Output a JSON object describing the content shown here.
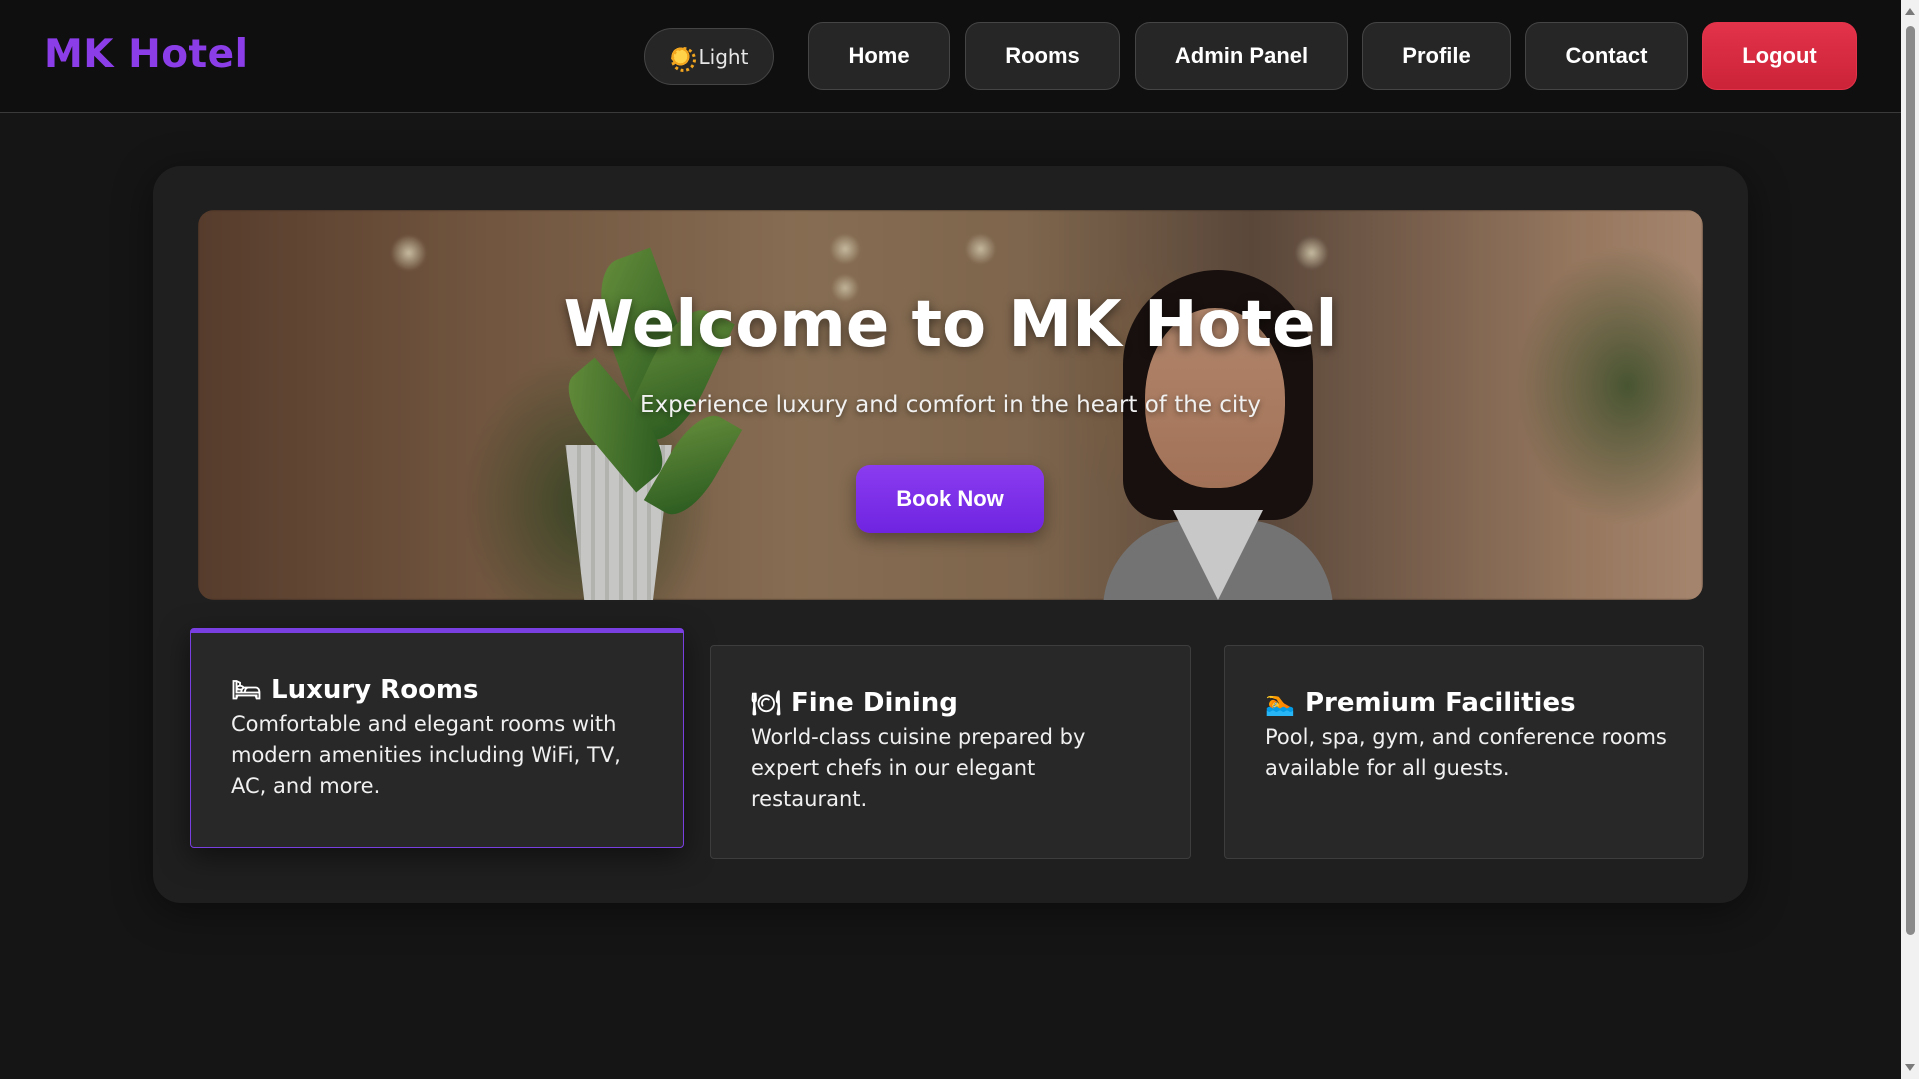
{
  "header": {
    "brand": "MK Hotel",
    "theme_toggle": {
      "icon": "sun-icon",
      "label": "Light"
    },
    "nav": [
      {
        "label": "Home"
      },
      {
        "label": "Rooms"
      },
      {
        "label": "Admin Panel"
      },
      {
        "label": "Profile"
      },
      {
        "label": "Contact"
      },
      {
        "label": "Logout"
      }
    ]
  },
  "hero": {
    "title": "Welcome to MK Hotel",
    "subtitle": "Experience luxury and comfort in the heart of the city",
    "button_label": "Book Now"
  },
  "features": [
    {
      "icon": "bed-icon",
      "glyph": "🛏",
      "title": "Luxury Rooms",
      "description": "Comfortable and elegant rooms with modern amenities including WiFi, TV, AC, and more."
    },
    {
      "icon": "plate-icon",
      "glyph": "🍽",
      "title": "Fine Dining",
      "description": "World-class cuisine prepared by expert chefs in our elegant restaurant."
    },
    {
      "icon": "swimmer-icon",
      "glyph": "🏊",
      "title": "Premium Facilities",
      "description": "Pool, spa, gym, and conference rooms available for all guests."
    }
  ],
  "colors": {
    "brand": "#8b3ee8",
    "accent": "#7a3fe0",
    "logout": "#d92a40",
    "background": "#151515",
    "card": "#1f1f1f"
  }
}
